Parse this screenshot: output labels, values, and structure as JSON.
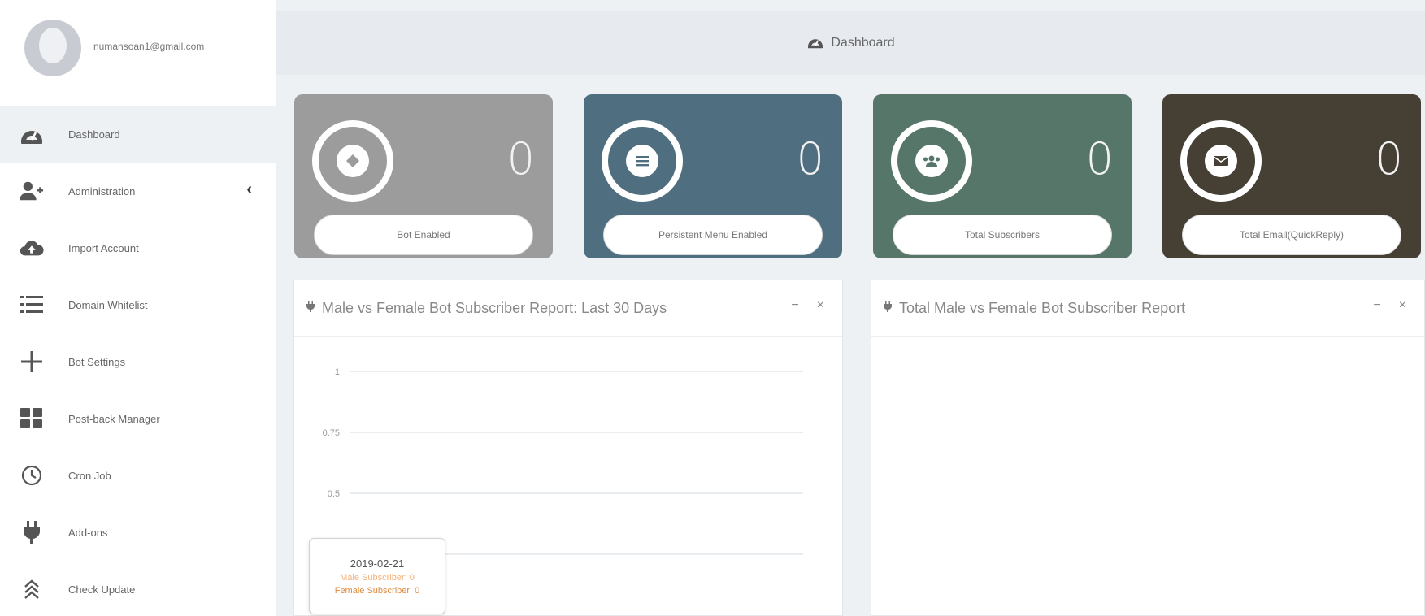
{
  "profile": {
    "email": "numansoan1@gmail.com"
  },
  "sidebar": {
    "items": [
      {
        "label": "Dashboard",
        "icon": "dashboard-icon"
      },
      {
        "label": "Administration",
        "icon": "add-user-icon"
      },
      {
        "label": "Import Account",
        "icon": "cloud-upload-icon"
      },
      {
        "label": "Domain Whitelist",
        "icon": "list-icon"
      },
      {
        "label": "Bot Settings",
        "icon": "plus-icon"
      },
      {
        "label": "Post-back Manager",
        "icon": "grid-icon"
      },
      {
        "label": "Cron Job",
        "icon": "clock-icon"
      },
      {
        "label": "Add-ons",
        "icon": "plug-icon"
      },
      {
        "label": "Check Update",
        "icon": "update-icon"
      }
    ],
    "chevron": "‹"
  },
  "header": {
    "title": "Dashboard"
  },
  "cards": [
    {
      "count": "0",
      "label": "Bot Enabled",
      "color": "#9c9c9c",
      "icon": "bot-icon"
    },
    {
      "count": "0",
      "label": "Persistent Menu Enabled",
      "color": "#4f6f80",
      "icon": "menu-icon"
    },
    {
      "count": "0",
      "label": "Total Subscribers",
      "color": "#557668",
      "icon": "users-icon"
    },
    {
      "count": "0",
      "label": "Total Email(QuickReply)",
      "color": "#453f34",
      "icon": "envelope-icon"
    }
  ],
  "panels": [
    {
      "title": "Male vs Female Bot Subscriber Report: Last 30 Days",
      "tools": [
        "−",
        "×"
      ],
      "chart": {
        "yticks": [
          "1",
          "0.75",
          "0.5",
          "0.25"
        ],
        "tooltip": {
          "date": "2019-02-21",
          "male": "Male Subscriber: 0",
          "female": "Female Subscriber: 0"
        }
      }
    },
    {
      "title": "Total Male vs Female Bot Subscriber Report",
      "tools": [
        "−",
        "×"
      ]
    }
  ],
  "chart_data": {
    "type": "line",
    "title": "Male vs Female Bot Subscriber Report: Last 30 Days",
    "x": [
      "2019-02-21"
    ],
    "series": [
      {
        "name": "Male Subscriber",
        "values": [
          0
        ]
      },
      {
        "name": "Female Subscriber",
        "values": [
          0
        ]
      }
    ],
    "yticks": [
      1,
      0.75,
      0.5,
      0.25
    ],
    "ylim": [
      0,
      1
    ],
    "grid": true
  }
}
